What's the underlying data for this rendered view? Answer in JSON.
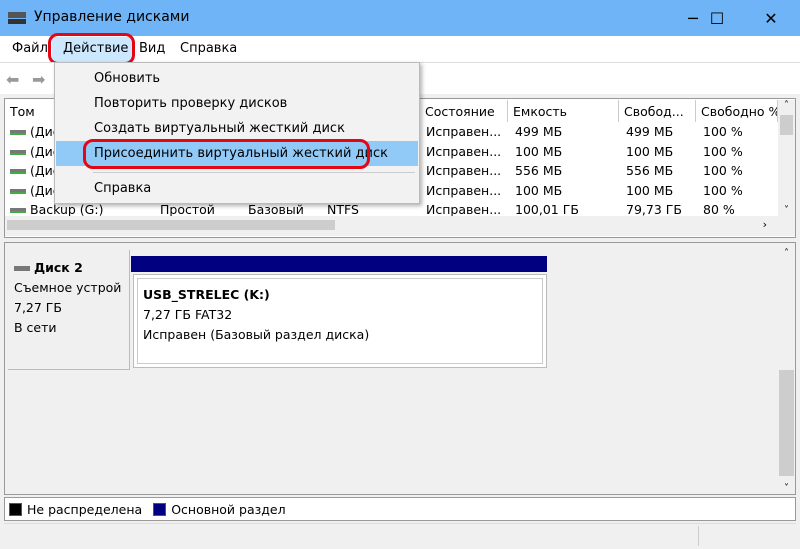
{
  "window": {
    "title": "Управление дисками",
    "minimize": "─",
    "maximize": "☐",
    "close": "✕"
  },
  "menubar": [
    "Файл",
    "Действие",
    "Вид",
    "Справка"
  ],
  "action_menu": {
    "items": [
      "Обновить",
      "Повторить проверку дисков",
      "Создать виртуальный жесткий диск",
      "Присоединить виртуальный жесткий диск",
      "Справка"
    ],
    "highlighted": "Присоединить виртуальный жесткий диск"
  },
  "volumes": {
    "columns": [
      "Том",
      "",
      "",
      "",
      "Состояние",
      "Емкость",
      "Свобод...",
      "Свободно %"
    ],
    "rows": [
      [
        "(Дис",
        "",
        "",
        "",
        "Исправен...",
        "499 МБ",
        "499 МБ",
        "100 %"
      ],
      [
        "(Дис",
        "",
        "",
        "",
        "Исправен...",
        "100 МБ",
        "100 МБ",
        "100 %"
      ],
      [
        "(Дис",
        "",
        "",
        "",
        "Исправен...",
        "556 МБ",
        "556 МБ",
        "100 %"
      ],
      [
        "(Дис",
        "",
        "",
        "",
        "Исправен...",
        "100 МБ",
        "100 МБ",
        "100 %"
      ],
      [
        "Backup (G:)",
        "Простой",
        "Базовый",
        "NTFS",
        "Исправен...",
        "100,01 ГБ",
        "79,73 ГБ",
        "80 %"
      ]
    ]
  },
  "disk": {
    "name": "Диск 2",
    "type": "Съемное устрой",
    "size": "7,27 ГБ",
    "status": "В сети",
    "partition": {
      "label": "USB_STRELEC  (K:)",
      "size_fs": "7,27 ГБ FAT32",
      "status": "Исправен (Базовый раздел диска)"
    }
  },
  "legend": [
    {
      "label": "Не распределена",
      "color": "#000000"
    },
    {
      "label": "Основной раздел",
      "color": "#000080"
    }
  ],
  "colors": {
    "titlebar": "#6fb4f7",
    "highlight": "#91c9f7",
    "annotation": "#e30613"
  }
}
